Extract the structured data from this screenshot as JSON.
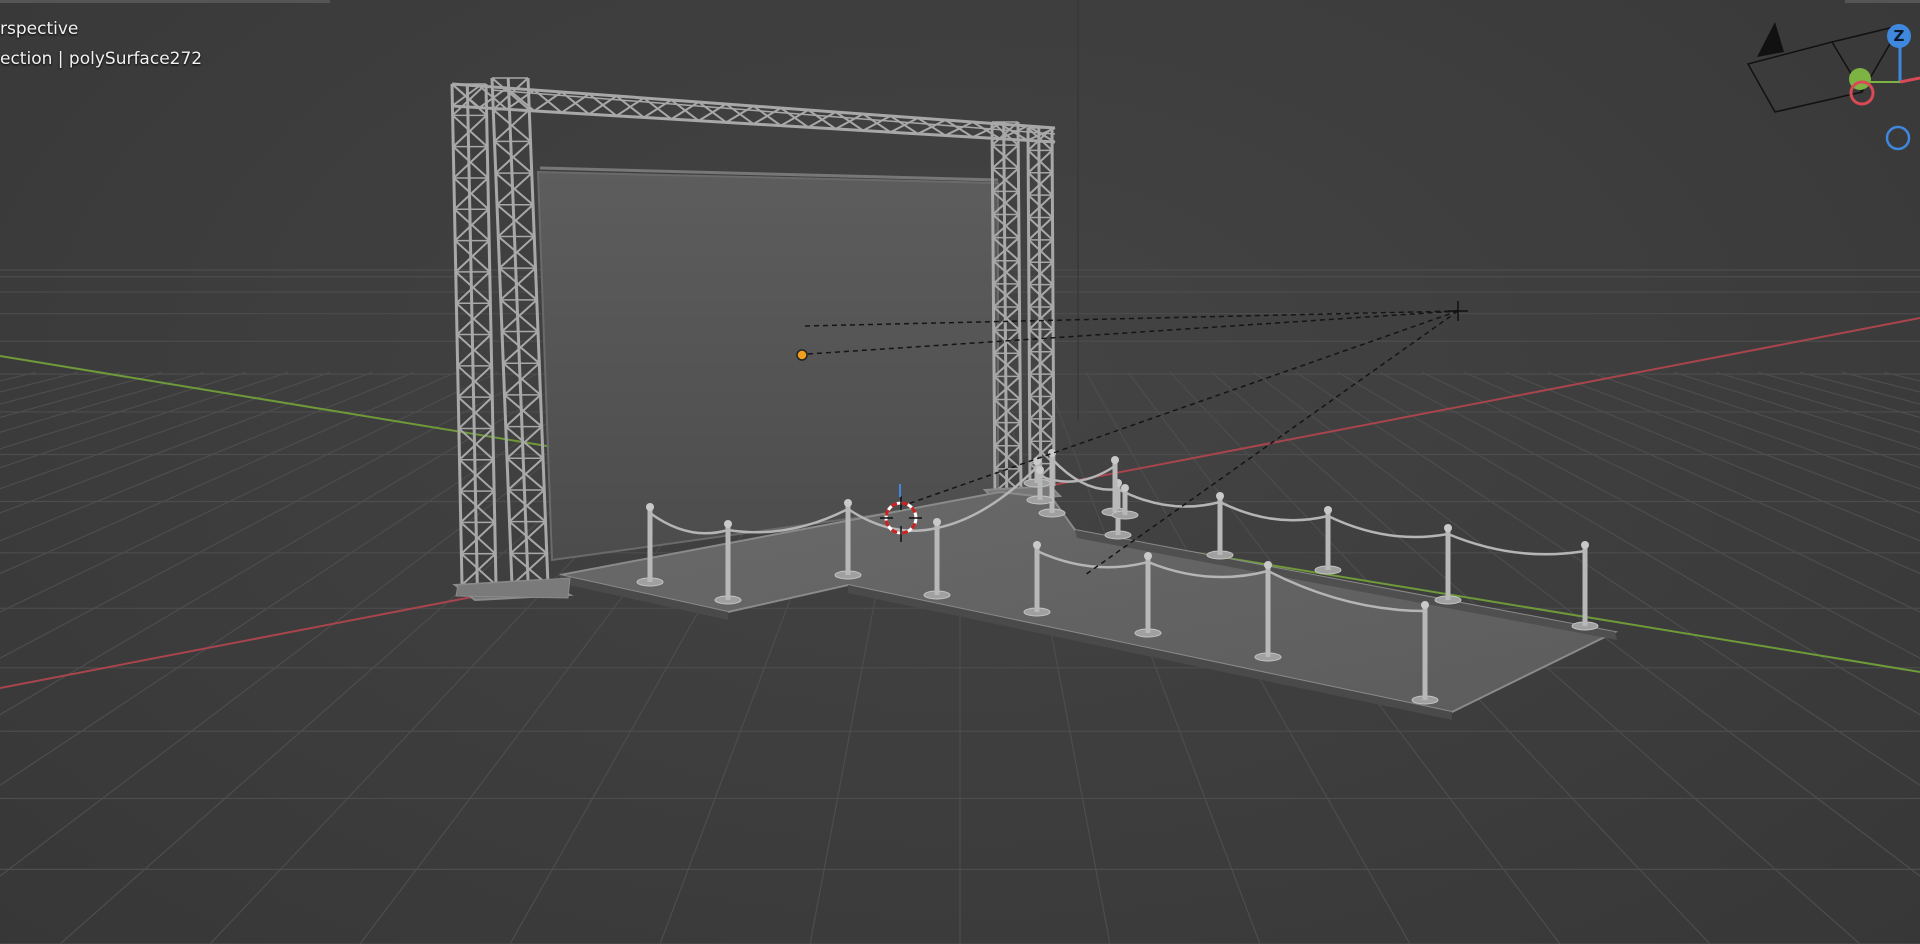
{
  "viewport": {
    "view_mode_label": "rspective",
    "collection_label": "ection",
    "separator": "|",
    "active_object": "polySurface272"
  },
  "nav_gizmo": {
    "z_axis_label": "Z"
  },
  "colors": {
    "background": "#3c3c3c",
    "grid": "#4c4c4c",
    "x_axis": "#a8454c",
    "y_axis": "#6e9a3a",
    "mesh_light": "#a2a2a2",
    "screen": "#555555",
    "z_gizmo": "#3f88dd",
    "x_gizmo": "#d94a55",
    "y_gizmo": "#7cb342",
    "origin_dot": "#f0a020"
  },
  "scene": {
    "objects": [
      "truss-frame",
      "backdrop-screen",
      "stage-platform",
      "stanchion-posts",
      "rope-barriers",
      "light-object",
      "camera-object",
      "3d-cursor"
    ]
  }
}
